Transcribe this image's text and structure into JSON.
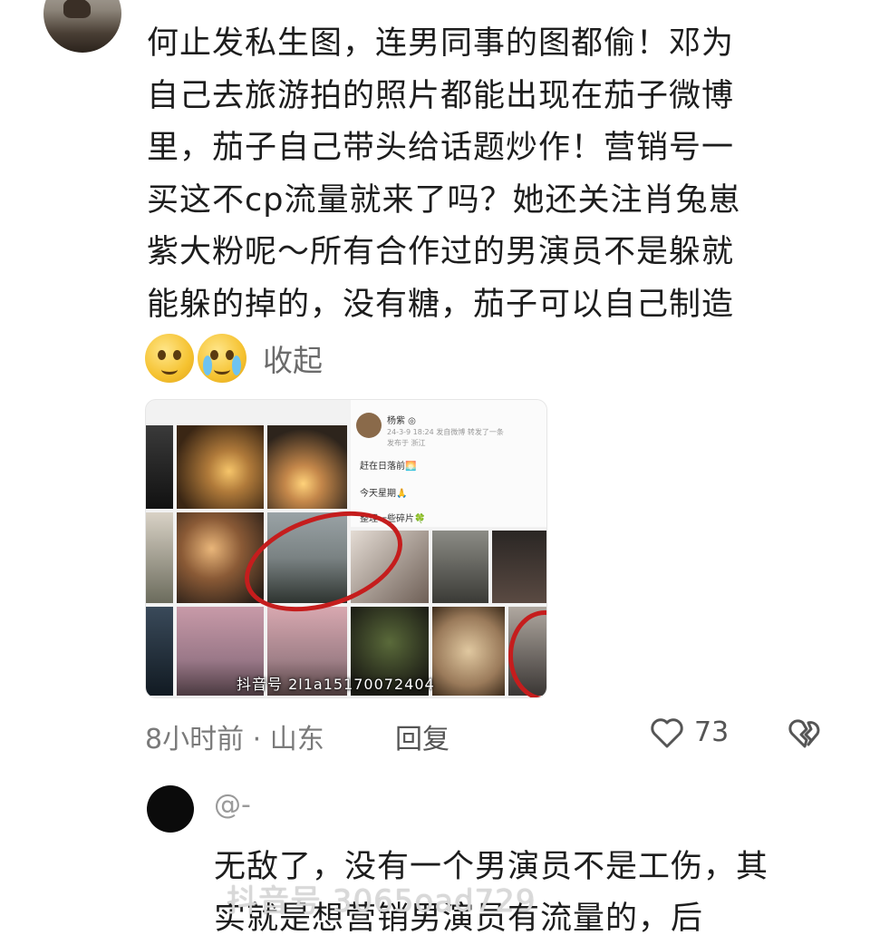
{
  "comment": {
    "lines": [
      "何止发私生图，连男同事的图都偷！邓为",
      "自己去旅游拍的照片都能出现在茄子微博",
      "里，茄子自己带头给话题炒作！营销号一",
      "买这不cp流量就来了吗？她还关注肖兔崽",
      "紫大粉呢～所有合作过的男演员不是躲就",
      "能躲的掉的，没有糖，茄子可以自己制造"
    ],
    "emojis": [
      "pleading-face-emoji",
      "crying-face-emoji"
    ],
    "collapse_label": "收起",
    "image": {
      "profile_name": "杨紫 ◎",
      "profile_meta": "24-3-9 18:24  发自微博  转发了一条",
      "profile_location": "发布于 浙江",
      "posts": [
        "赶在日落前🌅",
        "今天星期🙏",
        "整理一些碎片🍀"
      ],
      "watermark": "抖音号 2l1a15170072404"
    },
    "time_location": "8小时前 · 山东",
    "reply_label": "回复",
    "like_count": "73"
  },
  "reply": {
    "username": "@-",
    "lines": [
      "无敌了，没有一个男演员不是工伤，其",
      "实就是想营销男演员有流量的，后"
    ]
  },
  "watermark": "抖音号 3065oad729"
}
